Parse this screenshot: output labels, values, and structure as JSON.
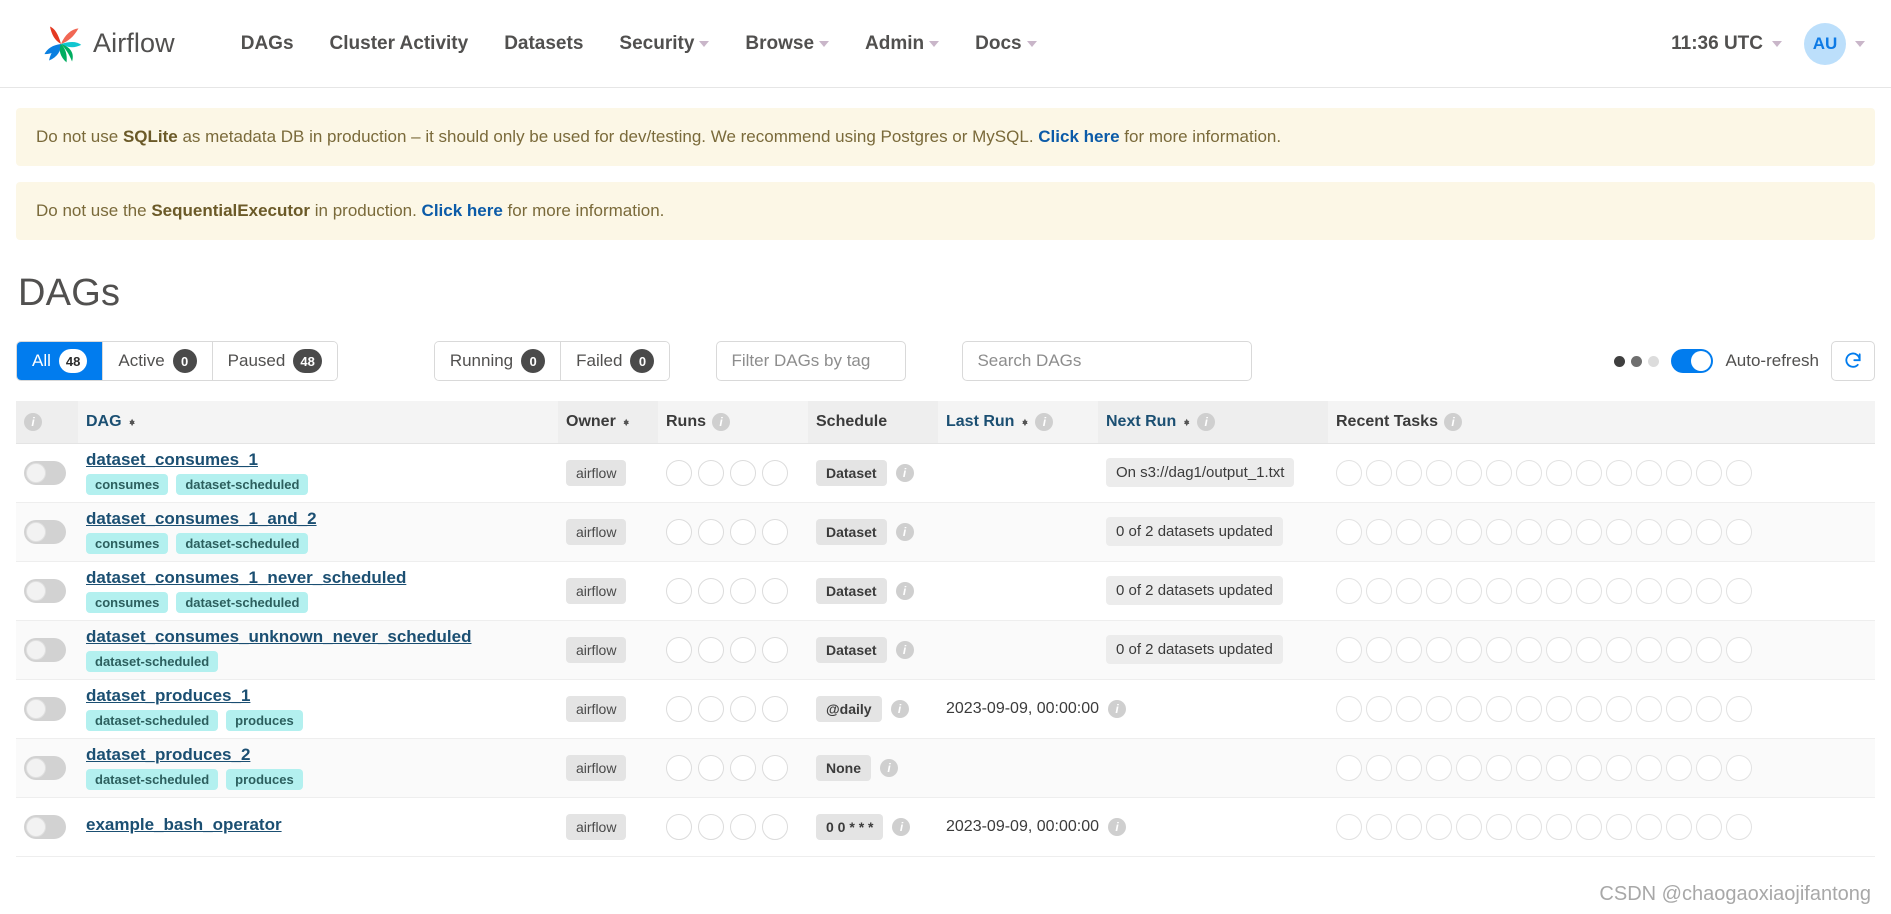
{
  "navbar": {
    "brand": "Airflow",
    "links": [
      {
        "label": "DAGs",
        "caret": false
      },
      {
        "label": "Cluster Activity",
        "caret": false
      },
      {
        "label": "Datasets",
        "caret": false
      },
      {
        "label": "Security",
        "caret": true
      },
      {
        "label": "Browse",
        "caret": true
      },
      {
        "label": "Admin",
        "caret": true
      },
      {
        "label": "Docs",
        "caret": true
      }
    ],
    "clock": "11:36 UTC",
    "avatar_initials": "AU"
  },
  "alerts": [
    {
      "pre": "Do not use ",
      "strong": "SQLite",
      "mid": " as metadata DB in production – it should only be used for dev/testing. We recommend using Postgres or MySQL. ",
      "link": "Click here",
      "post": " for more information."
    },
    {
      "pre": "Do not use the ",
      "strong": "SequentialExecutor",
      "mid": " in production. ",
      "link": "Click here",
      "post": " for more information."
    }
  ],
  "page": {
    "title": "DAGs"
  },
  "toolbar": {
    "status_filters": [
      {
        "label": "All",
        "count": "48",
        "active": true
      },
      {
        "label": "Active",
        "count": "0",
        "active": false
      },
      {
        "label": "Paused",
        "count": "48",
        "active": false
      }
    ],
    "run_filters": [
      {
        "label": "Running",
        "count": "0"
      },
      {
        "label": "Failed",
        "count": "0"
      }
    ],
    "tag_filter_placeholder": "Filter DAGs by tag",
    "tag_filter_value": "",
    "search_placeholder": "Search DAGs",
    "search_value": "",
    "auto_refresh_label": "Auto-refresh",
    "auto_refresh_on": true,
    "refresh_icon": "refresh-icon",
    "accent_color": "#017cee"
  },
  "table": {
    "columns": [
      {
        "label": "",
        "info": true
      },
      {
        "label": "DAG",
        "sortable": true
      },
      {
        "label": "Owner",
        "sortable": true
      },
      {
        "label": "Runs",
        "info": true
      },
      {
        "label": "Schedule"
      },
      {
        "label": "Last Run",
        "sortable": true,
        "info": true
      },
      {
        "label": "Next Run",
        "sortable": true,
        "info": true
      },
      {
        "label": "Recent Tasks",
        "info": true
      }
    ],
    "rows": [
      {
        "paused": true,
        "name": "dataset_consumes_1",
        "tags": [
          "consumes",
          "dataset-scheduled"
        ],
        "owner": "airflow",
        "runs": 4,
        "schedule": "Dataset",
        "last_run": "",
        "next_run": "On s3://dag1/output_1.txt",
        "next_run_type": "badge",
        "recent_tasks": 14
      },
      {
        "paused": true,
        "name": "dataset_consumes_1_and_2",
        "tags": [
          "consumes",
          "dataset-scheduled"
        ],
        "owner": "airflow",
        "runs": 4,
        "schedule": "Dataset",
        "last_run": "",
        "next_run": "0 of 2 datasets updated",
        "next_run_type": "badge",
        "recent_tasks": 14
      },
      {
        "paused": true,
        "name": "dataset_consumes_1_never_scheduled",
        "tags": [
          "consumes",
          "dataset-scheduled"
        ],
        "owner": "airflow",
        "runs": 4,
        "schedule": "Dataset",
        "last_run": "",
        "next_run": "0 of 2 datasets updated",
        "next_run_type": "badge",
        "recent_tasks": 14
      },
      {
        "paused": true,
        "name": "dataset_consumes_unknown_never_scheduled",
        "tags": [
          "dataset-scheduled"
        ],
        "owner": "airflow",
        "runs": 4,
        "schedule": "Dataset",
        "last_run": "",
        "next_run": "0 of 2 datasets updated",
        "next_run_type": "badge",
        "recent_tasks": 14
      },
      {
        "paused": true,
        "name": "dataset_produces_1",
        "tags": [
          "dataset-scheduled",
          "produces"
        ],
        "owner": "airflow",
        "runs": 4,
        "schedule": "@daily",
        "last_run": "2023-09-09, 00:00:00",
        "next_run": "",
        "next_run_type": "none",
        "recent_tasks": 14
      },
      {
        "paused": true,
        "name": "dataset_produces_2",
        "tags": [
          "dataset-scheduled",
          "produces"
        ],
        "owner": "airflow",
        "runs": 4,
        "schedule": "None",
        "last_run": "",
        "next_run": "",
        "next_run_type": "none",
        "recent_tasks": 14
      },
      {
        "paused": true,
        "name": "example_bash_operator",
        "tags": [],
        "owner": "airflow",
        "runs": 4,
        "schedule": "0 0 * * *",
        "last_run": "2023-09-09, 00:00:00",
        "next_run": "",
        "next_run_type": "none",
        "recent_tasks": 14
      }
    ]
  },
  "watermark": "CSDN @chaogaoxiaojifantong"
}
